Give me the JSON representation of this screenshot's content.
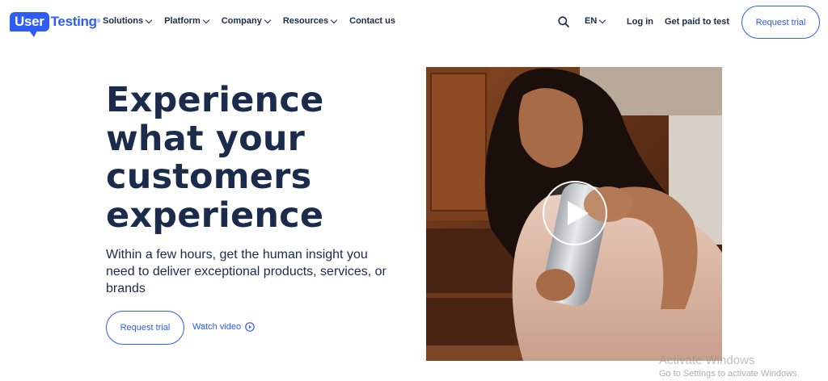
{
  "header": {
    "logo": {
      "user": "User",
      "testing": "Testing"
    },
    "nav": [
      {
        "label": "Solutions"
      },
      {
        "label": "Platform"
      },
      {
        "label": "Company"
      },
      {
        "label": "Resources"
      },
      {
        "label": "Contact us"
      }
    ],
    "language": "EN",
    "login_label": "Log in",
    "get_paid_label": "Get paid to test",
    "request_trial_label": "Request trial"
  },
  "hero": {
    "title_lines": [
      "Experience",
      "what your",
      "customers",
      "experience"
    ],
    "subtitle": "Within a few hours, get the human insight you need to deliver exceptional products, services, or brands",
    "request_trial_label": "Request trial",
    "watch_video_label": "Watch video"
  },
  "watermark": {
    "line1": "Activate Windows",
    "line2": "Go to Settings to activate Windows."
  },
  "colors": {
    "brand_blue": "#2d5cf6",
    "navy_text": "#1b2b4b"
  },
  "icons": {
    "search": "search-icon",
    "play": "play-icon",
    "watch_video": "play-circle-icon"
  }
}
